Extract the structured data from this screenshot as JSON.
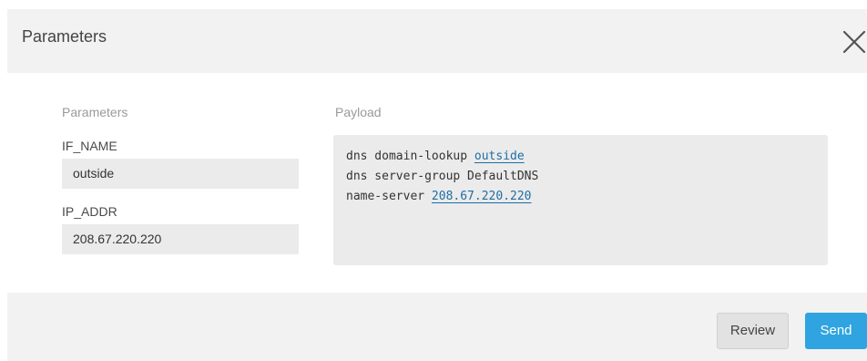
{
  "dialog": {
    "title": "Parameters",
    "close_icon": "close-icon"
  },
  "parameters": {
    "heading": "Parameters",
    "fields": [
      {
        "label": "IF_NAME",
        "value": "outside"
      },
      {
        "label": "IP_ADDR",
        "value": "208.67.220.220"
      }
    ]
  },
  "payload": {
    "heading": "Payload",
    "lines": [
      {
        "text": "dns domain-lookup ",
        "var": "outside"
      },
      {
        "text": "dns server-group DefaultDNS",
        "var": ""
      },
      {
        "text": "name-server ",
        "var": "208.67.220.220"
      }
    ]
  },
  "footer": {
    "review_label": "Review",
    "send_label": "Send"
  },
  "colors": {
    "accent": "#2fa4e0",
    "link": "#1d6fa5",
    "panel": "#f2f2f2",
    "field": "#ebebeb"
  }
}
